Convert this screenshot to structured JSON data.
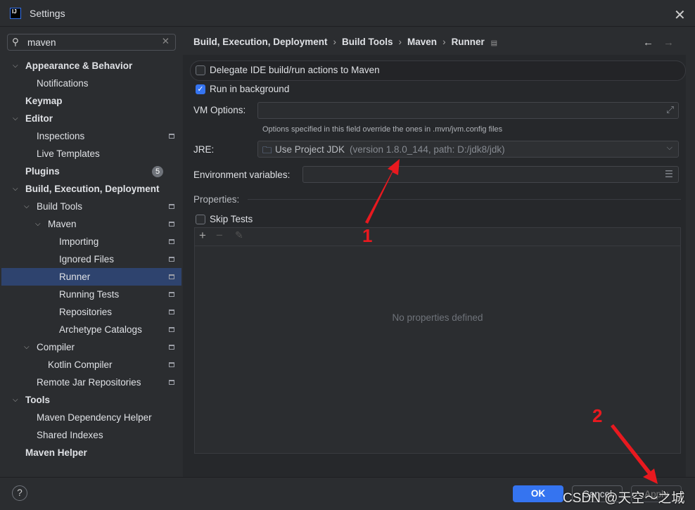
{
  "window": {
    "title": "Settings",
    "logo": "IJ"
  },
  "search": {
    "value": "maven"
  },
  "tree": [
    {
      "label": "Appearance & Behavior",
      "depth": 0,
      "chev": true,
      "bold": true
    },
    {
      "label": "Notifications",
      "depth": 1
    },
    {
      "label": "Keymap",
      "depth": 0,
      "bold": true
    },
    {
      "label": "Editor",
      "depth": 0,
      "chev": true,
      "bold": true
    },
    {
      "label": "Inspections",
      "depth": 1,
      "mark": true
    },
    {
      "label": "Live Templates",
      "depth": 1
    },
    {
      "label": "Plugins",
      "depth": 0,
      "bold": true,
      "badge": "5"
    },
    {
      "label": "Build, Execution, Deployment",
      "depth": 0,
      "chev": true,
      "bold": true
    },
    {
      "label": "Build Tools",
      "depth": 1,
      "chev": true,
      "mark": true
    },
    {
      "label": "Maven",
      "depth": 2,
      "chev": true,
      "mark": true
    },
    {
      "label": "Importing",
      "depth": 3,
      "mark": true
    },
    {
      "label": "Ignored Files",
      "depth": 3,
      "mark": true
    },
    {
      "label": "Runner",
      "depth": 3,
      "mark": true,
      "selected": true
    },
    {
      "label": "Running Tests",
      "depth": 3,
      "mark": true
    },
    {
      "label": "Repositories",
      "depth": 3,
      "mark": true
    },
    {
      "label": "Archetype Catalogs",
      "depth": 3,
      "mark": true
    },
    {
      "label": "Compiler",
      "depth": 1,
      "chev": true,
      "mark": true
    },
    {
      "label": "Kotlin Compiler",
      "depth": 2,
      "mark": true
    },
    {
      "label": "Remote Jar Repositories",
      "depth": 1,
      "mark": true
    },
    {
      "label": "Tools",
      "depth": 0,
      "chev": true,
      "bold": true
    },
    {
      "label": "Maven Dependency Helper",
      "depth": 1
    },
    {
      "label": "Shared Indexes",
      "depth": 1
    },
    {
      "label": "Maven Helper",
      "depth": 0,
      "bold": true
    }
  ],
  "breadcrumb": [
    "Build, Execution, Deployment",
    "Build Tools",
    "Maven",
    "Runner"
  ],
  "runner": {
    "delegate": "Delegate IDE build/run actions to Maven",
    "delegate_checked": false,
    "background": "Run in background",
    "background_checked": true,
    "vm_label": "VM Options:",
    "vm_value": "",
    "vm_hint": "Options specified in this field override the ones in .mvn/jvm.config files",
    "jre_label": "JRE:",
    "jre_value": "Use Project JDK",
    "jre_detail": "(version 1.8.0_144, path: D:/jdk8/jdk)",
    "env_label": "Environment variables:",
    "env_value": "",
    "properties_label": "Properties:",
    "skip_tests": "Skip Tests",
    "skip_checked": false,
    "empty": "No properties defined"
  },
  "buttons": {
    "ok": "OK",
    "cancel": "Cancel",
    "apply": "Apply",
    "help": "?"
  },
  "annotations": {
    "one": "1",
    "two": "2"
  },
  "watermark": "CSDN @天空～之城",
  "colors": {
    "accent": "#3574f0",
    "selection": "#2e436e",
    "annotation": "#e8191f"
  }
}
